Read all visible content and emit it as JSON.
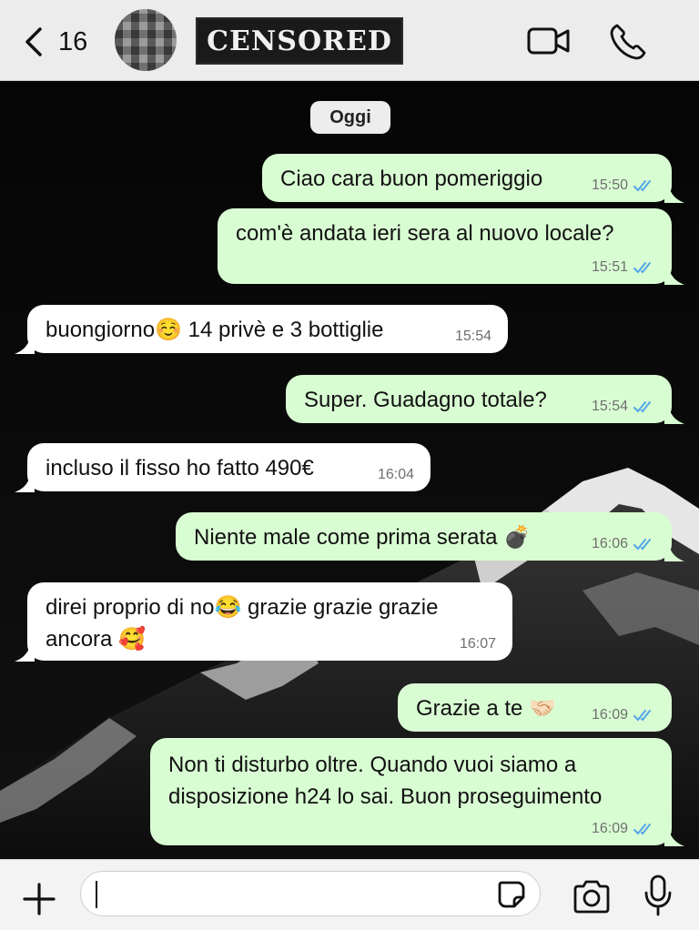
{
  "header": {
    "back_count": "16",
    "contact_name_overlay": "CENSORED"
  },
  "date_label": "Oggi",
  "messages": [
    {
      "dir": "out",
      "lines": [
        "Ciao cara buon pomeriggio"
      ],
      "time": "15:50"
    },
    {
      "dir": "out",
      "lines": [
        "com'è andata ieri sera al nuovo locale?"
      ],
      "time": "15:51"
    },
    {
      "dir": "in",
      "lines": [
        "buongiorno☺️ 14 privè e 3 bottiglie"
      ],
      "time": "15:54"
    },
    {
      "dir": "out",
      "lines": [
        "Super. Guadagno totale?"
      ],
      "time": "15:54"
    },
    {
      "dir": "in",
      "lines": [
        "incluso il fisso ho fatto 490€"
      ],
      "time": "16:04"
    },
    {
      "dir": "out",
      "lines": [
        "Niente male come prima serata 💣"
      ],
      "time": "16:06"
    },
    {
      "dir": "in",
      "lines": [
        "direi proprio di no😂 grazie grazie grazie",
        "ancora 🥰"
      ],
      "time": "16:07"
    },
    {
      "dir": "out",
      "lines": [
        "Grazie a te 🤝🏻"
      ],
      "time": "16:09"
    },
    {
      "dir": "out",
      "lines": [
        "Non ti disturbo oltre. Quando vuoi siamo a",
        "disposizione h24 lo sai. Buon proseguimento"
      ],
      "time": "16:09"
    }
  ],
  "composer": {
    "value": ""
  },
  "icons": {
    "back": "chevron-left-icon",
    "video": "video-camera-icon",
    "call": "phone-icon",
    "attach": "plus-icon",
    "sticker": "sticker-icon",
    "camera": "camera-icon",
    "mic": "microphone-icon"
  },
  "colors": {
    "outgoing_bubble": "#d9fdd3",
    "incoming_bubble": "#ffffff",
    "read_tick": "#53a6e8"
  }
}
